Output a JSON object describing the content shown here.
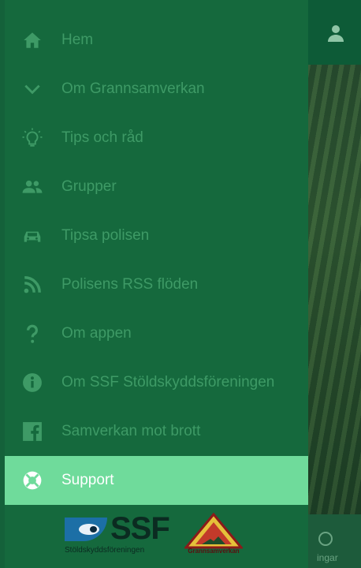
{
  "drawer": {
    "items": [
      {
        "label": "Hem",
        "icon": "home-icon",
        "active": false
      },
      {
        "label": "Om Grannsamverkan",
        "icon": "chevron-down-icon",
        "active": false
      },
      {
        "label": "Tips och råd",
        "icon": "lightbulb-icon",
        "active": false
      },
      {
        "label": "Grupper",
        "icon": "group-icon",
        "active": false
      },
      {
        "label": "Tipsa polisen",
        "icon": "car-icon",
        "active": false
      },
      {
        "label": "Polisens RSS flöden",
        "icon": "rss-icon",
        "active": false
      },
      {
        "label": "Om appen",
        "icon": "question-icon",
        "active": false
      },
      {
        "label": "Om SSF Stöldskyddsföreningen",
        "icon": "info-icon",
        "active": false
      },
      {
        "label": "Samverkan mot brott",
        "icon": "facebook-icon",
        "active": false
      },
      {
        "label": "Support",
        "icon": "lifebuoy-icon",
        "active": true
      }
    ],
    "logos": {
      "ssf_text": "SSF",
      "ssf_sub": "Stöldskyddsföreningen",
      "grannsamverkan_text": "Grannsamverkan"
    }
  },
  "background": {
    "bottom_tab_partial_label": "ingar"
  },
  "colors": {
    "drawer_bg": "#15693d",
    "item_text": "#3e9a66",
    "active_bg": "#6fdb9b",
    "active_text": "#ffffff"
  }
}
